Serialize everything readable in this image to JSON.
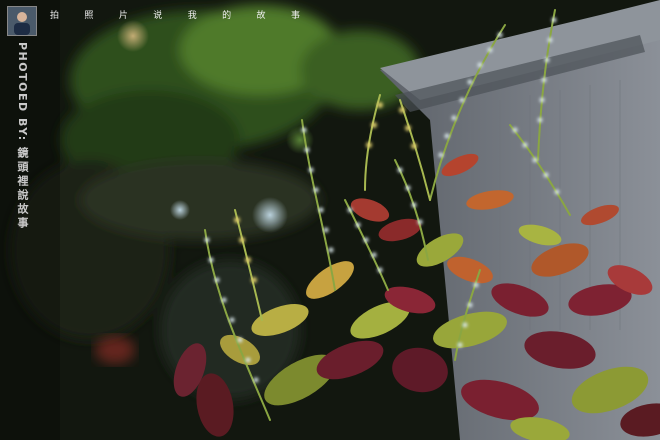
{
  "photo": {
    "title_chars": [
      "拍",
      "照",
      "片",
      "说",
      "我",
      "的",
      "故",
      "事"
    ],
    "credit_prefix": "PHOTOED BY:",
    "credit_name": "鏡頭裡說故事",
    "icons": {
      "avatar": "avatar-icon"
    },
    "colors": {
      "leaf_red": "#7a2030",
      "leaf_green": "#9aa83a",
      "bokeh_green": "#3f6a2a",
      "wall_gray": "#7b8088",
      "text_white": "#f0f0f0"
    }
  }
}
